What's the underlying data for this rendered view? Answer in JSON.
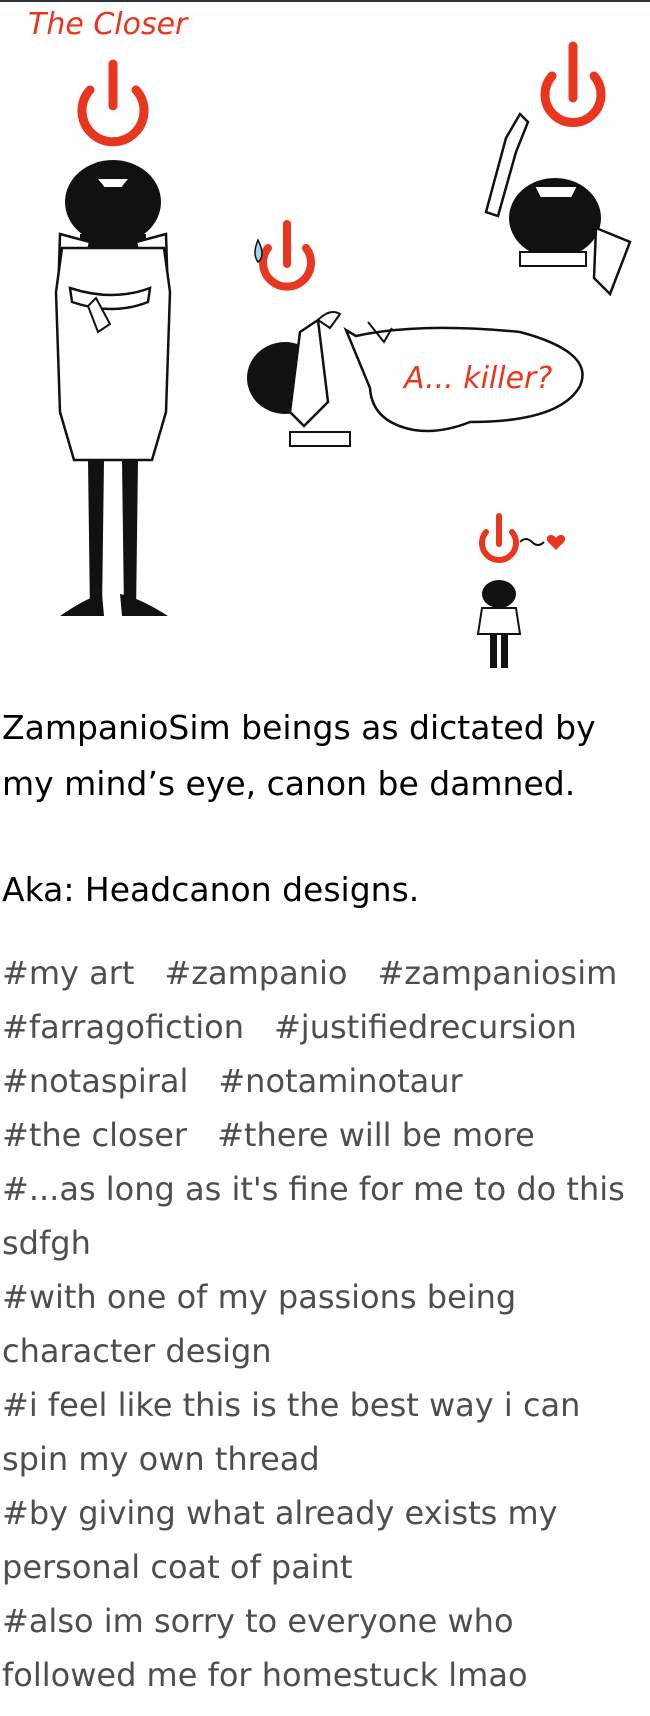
{
  "art": {
    "title_text": "The Closer",
    "speech_text": "A... killer?"
  },
  "post": {
    "caption_line1": "ZampanioSim beings as dictated by my mind’s eye, canon be damned.",
    "caption_line2": "Aka: Headcanon designs."
  },
  "tags": {
    "row1": [
      "#my art",
      "#zampanio",
      "#zampaniosim"
    ],
    "row2": [
      "#farragofiction",
      "#justifiedrecursion"
    ],
    "row3": [
      "#notaspiral",
      "#notaminotaur"
    ],
    "row4": [
      "#the closer",
      "#there will be more"
    ],
    "long": [
      "#...as long as it's fine for me to do this sdfgh",
      "#with one of my passions being character design",
      "#i feel like this is the best way i can spin my own thread",
      "#by giving what already exists my personal coat of paint",
      "#also im sorry to everyone who followed me for homestuck lmao"
    ]
  },
  "colors": {
    "power_red": "#e8361f",
    "tag_gray": "#4e4e4e"
  },
  "icons": [
    "power-symbol-icon",
    "heart-icon"
  ]
}
